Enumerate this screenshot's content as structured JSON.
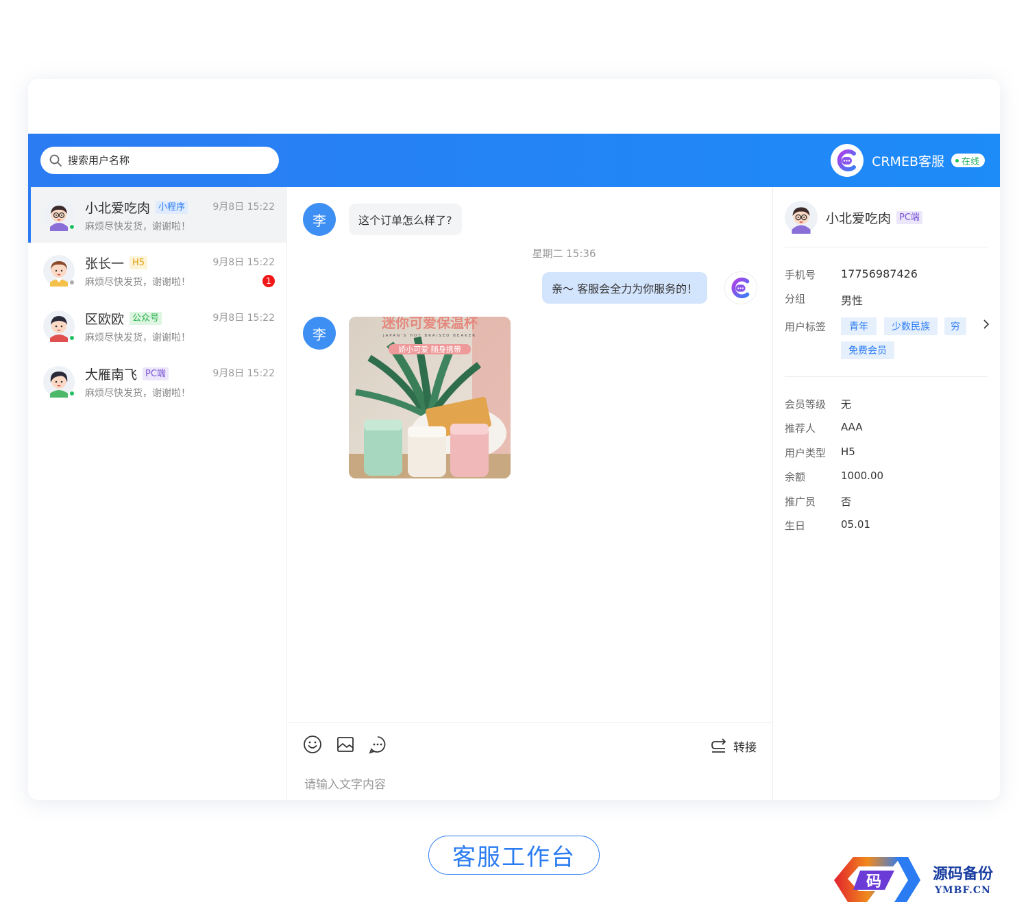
{
  "search": {
    "placeholder": "搜索用户名称"
  },
  "brand": {
    "name": "CRMEB客服",
    "status": "在线"
  },
  "conversations": [
    {
      "name": "小北爱吃肉",
      "tag": "小程序",
      "tag_color": "blue",
      "preview": "麻烦尽快发货，谢谢啦！",
      "time": "9月8日 15:22",
      "online": true,
      "active": true
    },
    {
      "name": "张长一",
      "tag": "H5",
      "tag_color": "yellow",
      "preview": "麻烦尽快发货，谢谢啦！",
      "time": "9月8日 15:22",
      "online": false,
      "unread": "1"
    },
    {
      "name": "区欧欧",
      "tag": "公众号",
      "tag_color": "green",
      "preview": "麻烦尽快发货，谢谢啦！",
      "time": "9月8日 15:22",
      "online": true
    },
    {
      "name": "大雁南飞",
      "tag": "PC端",
      "tag_color": "purple",
      "preview": "麻烦尽快发货，谢谢啦！",
      "time": "9月8日 15:22",
      "online": true
    }
  ],
  "chat": {
    "customer_avatar_char": "李",
    "message_1": "这个订单怎么样了?",
    "timestamp": "星期二 15:36",
    "reply_1": "亲～ 客服会全力为你服务的！",
    "image": {
      "title": "迷你可爱保温杯",
      "subtitle": "JAPAN'S HOT BRAISED BEAKER",
      "banner": "娇小可爱 随身携带"
    },
    "transfer_label": "转接",
    "input_placeholder": "请输入文字内容"
  },
  "profile": {
    "name": "小北爱吃肉",
    "platform": "PC端",
    "phone_label": "手机号",
    "phone": "17756987426",
    "group_label": "分组",
    "group": "男性",
    "tags_label": "用户标签",
    "tags": [
      "青年",
      "少数民族",
      "穷",
      "免费会员"
    ],
    "level_label": "会员等级",
    "level": "无",
    "referrer_label": "推荐人",
    "referrer": "AAA",
    "type_label": "用户类型",
    "type": "H5",
    "balance_label": "余额",
    "balance": "1000.00",
    "promoter_label": "推广员",
    "promoter": "否",
    "birthday_label": "生日",
    "birthday": "05.01"
  },
  "footer": {
    "title": "客服工作台"
  },
  "watermark": {
    "logo_char": "码",
    "name": "源码备份",
    "url": "YMBF.CN"
  },
  "colors": {
    "accent": "#2b7cf2",
    "online": "#20c060",
    "unread": "#f01818"
  }
}
